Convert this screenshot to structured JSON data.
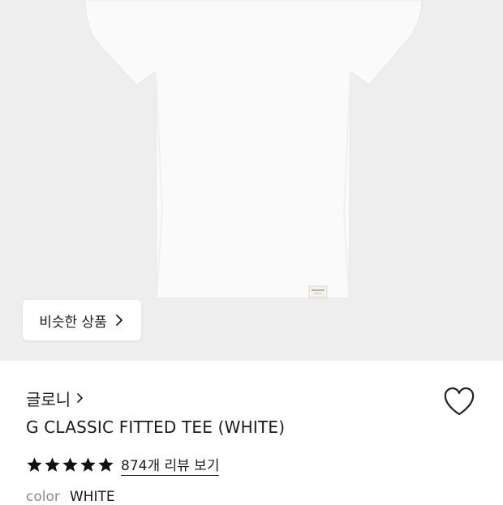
{
  "similar": {
    "label": "비슷한 상품"
  },
  "product": {
    "brand": "글로니",
    "title": "G CLASSIC FITTED TEE (WHITE)",
    "rating": 5,
    "reviews_link": "874개 리뷰 보기",
    "color_label": "color",
    "color_value": "WHITE"
  },
  "colors": {
    "hero_background": "#eeeeee",
    "text": "#1a1a1a",
    "muted": "#8a8a8a",
    "star": "#111111"
  },
  "icons": {
    "brand_chevron": "chevron-right-icon",
    "similar_chevron": "chevron-right-icon",
    "wishlist": "heart-outline-icon",
    "rating": "star-filled-icon"
  }
}
